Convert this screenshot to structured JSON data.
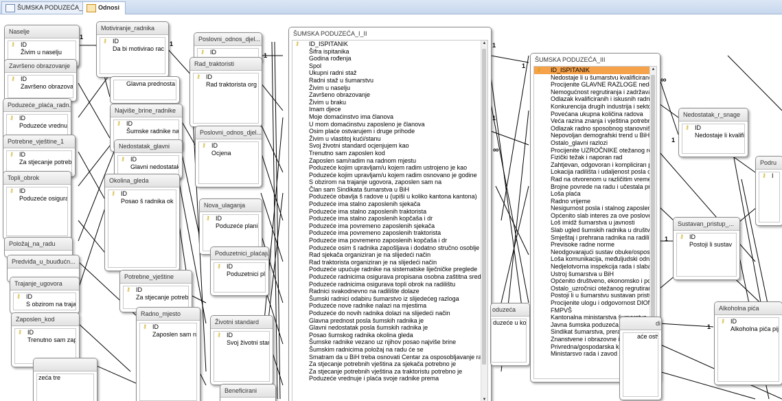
{
  "tabs": [
    {
      "label": "ŠUMSKA PODUZEĆA_I_II",
      "icon": "table-icon",
      "active": false
    },
    {
      "label": "Odnosi",
      "icon": "relationships-icon",
      "active": true
    }
  ],
  "rel": {
    "one": "1",
    "many": "∞"
  },
  "tables": {
    "naselje": {
      "title": "Naselje",
      "fields": [
        "ID",
        "Živim u naselju"
      ]
    },
    "zavrseno": {
      "title": "Završeno obrazovanje",
      "fields": [
        "ID",
        "Završeno obrazova"
      ]
    },
    "placa": {
      "title": "Poduzeće_plaća_radn...",
      "fields": [
        "ID",
        "Poduzeće vrednuje"
      ]
    },
    "vjestine1": {
      "title": "Potrebne_vještine_1",
      "fields": [
        "ID",
        "Za stjecanje potreb"
      ]
    },
    "topli": {
      "title": "Topli_obrok",
      "fields": [
        "ID",
        "Poduzeće osigurav"
      ]
    },
    "polozaj": {
      "title": "Položaj_na_radu",
      "fields": []
    },
    "predvida": {
      "title": "Predviđa_u_buuđućn...",
      "fields": []
    },
    "trajanje": {
      "title": "Trajanje_ugovora",
      "fields": [
        "ID",
        "S obzirom na trajar"
      ]
    },
    "zaposlen": {
      "title": "Zaposlen_kod",
      "fields": [
        "ID",
        "Trenutno sam zapo"
      ]
    },
    "motiviranje": {
      "title": "Motiviranje_radnika",
      "fields": [
        "ID",
        "Da bi motivirao rac"
      ]
    },
    "glavna": {
      "title": "",
      "fields": [
        "Glavna prednosta"
      ]
    },
    "najvise": {
      "title": "Najviše_brine_radnike",
      "fields": [
        "ID",
        "Šumske radnike na"
      ]
    },
    "nedostatakg": {
      "title": "Nedostatak_glavni",
      "fields": [
        "ID",
        "Glavni nedostatak"
      ]
    },
    "okolina": {
      "title": "Okolina_gleda",
      "fields": [
        "ID",
        "Posao š radnika ok"
      ]
    },
    "vjestine": {
      "title": "Potrebne_vještine",
      "fields": [
        "ID",
        "Za stjecanje potreb"
      ]
    },
    "radno": {
      "title": "Radno_mjesto",
      "fields": [
        "ID",
        "Zaposlen sam na ra"
      ]
    },
    "poslovni1": {
      "title": "Poslovni_odnos_djel...",
      "fields": [
        "ID"
      ]
    },
    "traktoristi": {
      "title": "Rad_traktoristi",
      "fields": [
        "ID",
        "Rad traktorista org"
      ]
    },
    "poslovni2": {
      "title": "Poslovni_odnos_djel...",
      "fields": [
        "ID",
        "Ocjena"
      ]
    },
    "nova": {
      "title": "Nova_ulaganja",
      "fields": [
        "ID",
        "Poduzeće planira n"
      ]
    },
    "poduzetnici": {
      "title": "Poduzetnici_plaćaju_...",
      "fields": [
        "ID",
        "Poduzetnici plaćaju"
      ]
    },
    "zivotni": {
      "title": "Životni standard",
      "fields": [
        "ID",
        "Svoj životni standa"
      ]
    },
    "beneficirani": {
      "title": "Beneficirani",
      "fields": []
    },
    "nedostatakr": {
      "title": "Nedostatak_r_snage",
      "fields": [
        "ID",
        "Nedostaje li kvalifik"
      ]
    },
    "sustavan": {
      "title": "Sustavan_pristup_...",
      "fields": [
        "ID",
        "Postoji li sustav"
      ]
    },
    "alkoholna": {
      "title": "Alkoholna pića",
      "fields": [
        "ID",
        "Alkoholna pića pije"
      ]
    },
    "podru": {
      "title": "Podru",
      "fields": [
        "I"
      ]
    },
    "poduzeca_partial": {
      "title": "oduzeća",
      "fields": [
        "duzeće u ko"
      ]
    },
    "di_partial": {
      "title": "di",
      "fields": [
        "aće ostvaru"
      ]
    },
    "partial_tre": {
      "title": "",
      "fields": [
        "zeća tre"
      ]
    }
  },
  "main1": {
    "title": "ŠUMSKA PODUZEĆA_I_II",
    "fields": [
      "ID_ISPITANIK",
      "Šifra ispitanika",
      "Godina rođenja",
      "Spol",
      "Ukupni radni staž",
      "Radni staž u šumarstvu",
      "Živim u naselju",
      "Završeno obrazovanje",
      "Živim u braku",
      "Imam djece",
      "Moje domaćinstvo ima članova",
      "U mom domaćinstvu zaposleno je članova",
      "Osim plaće ostvarujem i druge prihode",
      "Živim u vlastitoj kući/stanu",
      "Svoj životni standard ocjenjujem kao",
      "Trenutno sam zaposlen kod",
      "Zaposlen sam/radim na radnom mjestu",
      "Poduzeće kojim upravljam/u kojem radim ustrojeno je kao",
      "Poduzeće kojim upravljam/u kojem radim osnovano je godine",
      "S obzirom na trajanje ugovora, zaposlen sam na",
      "Član sam Sindikata šumarstva u BiH",
      "Poduzeće obavlja š radove u (upiši u koliko kantona kantona)",
      "Poduzeće ima stalno zaposlenih sjekača",
      "Poduzeće ima stalno zaposlenih traktorista",
      "Poduzeće ima stalno zaposlenih kopčaša i dr",
      "Poduzeće ima povremeno zaposlenih sjekača",
      "Poduzeće ima povremeno zaposlenih traktorista",
      "Poduzeće ima povremeno zaposlenih kopčaša i dr",
      "Poduzeće osim š radnika zapošljava i dodatno stručno osoblje",
      "Rad sjekača organiziran je na slijedeći način",
      "Rad traktorista organiziran je na slijedeći način",
      "Poduzeće upućuje radnike na sistematske liječničke preglede",
      "Poduzeće radnicima osigurava propisana osobna zaštitna sredstva",
      "Poduzeće radnicima osigurava topli obrok na radilištu",
      "Radnici svakodnevno na radilište dolaze",
      "Šumski radnici odabiru šumarstvo iz slijedećeg razloga",
      "Poduzeće nove radnike nalazi na mjestima",
      "Poduzeće do novih radnika dolazi na slijedeći način",
      "Glavna prednost posla šumskih radnika je",
      "Glavni nedostatak posla šumskih radnika je",
      "Posao šumskog radnika okolina gleda",
      "Šumske radnike vezano uz njihov posao najviše brine",
      "Šumskim radnicima položaj na radu će se",
      "Smatram da u BiH treba osnovati Centar za osposobljavanje radnik",
      "Za stjecanje potrebnih vještina za sjekača potrebno je",
      "Za stjecanje potrebnih vještina za traktoristu potrebno je",
      "Poduzeće vrednuje i plaća svoje radnike prema"
    ]
  },
  "main2": {
    "title": "ŠUMSKA PODUZEĆA_III",
    "fields": [
      "ID_ISPITANIK",
      "Nedostaje li u šumarstvu kvalificirane r s",
      "Procijenite GLAVNE RAZLOGE nedostatk",
      "Nemogućnost regrutiranja i zadržavanja",
      "Odlazak kvalificiranih i iskusnih radnika",
      "Konkurencija drugih industrija i sektora",
      "Povećana ukupna količina radova",
      "Veća razina znanja i vještina potrebnih z",
      "Odlazak radno sposobnog stanovništva",
      "Nepovoljan demografski trend u BiH",
      "Ostalo_glavni razlozi",
      "Procijenite UZROČNIKE otežanog regruti",
      "Fizički težak i naporan rad",
      "Zahtjevan, odgovoran i kompliciran posa",
      "Lokacija radilišta i udaljenost posla od k",
      "Rad na otvorenom u različitim vremenski",
      "Brojne povrede na radu i učestala profes",
      "Loša plaća",
      "Radno vrijeme",
      "Nesigurnost posla i stalnog zaposlenja",
      "Općenito slab interes za ove poslove",
      "Loš imidž šumarstva u javnosti",
      "Slab ugled šumskih radnika u društvu",
      "Smještaj i prehrana radnika na radilištu",
      "Previsoke radne norme",
      "Neodgovarajući sustav obuke/osposoblj",
      "Loša komunikacija, međuljudski odnosi",
      "Nedjelotvorna inspekcija rada i slaba zaš",
      "Ustroj šumarstva u BiH",
      "Općenito društveno, ekonomsko i politi",
      "Ostalo_uzročnici otežanog regrutiranja",
      "Postoji li u šumarstvu sustavan pristup r",
      "Procijenite ulogu i odgovornost DIONIK",
      "FMPVŠ",
      "Kantonalna ministarstva šumarstva",
      "Javna šumska poduzeća, ŠGD/ŠPP",
      "Sindikat šumarstva, prerade drveta i pap",
      "Znanstvene i obrazovne institucije",
      "Privredna/gospodarska komora",
      "Ministarsvo rada i zavod za zapošljavanje"
    ]
  }
}
